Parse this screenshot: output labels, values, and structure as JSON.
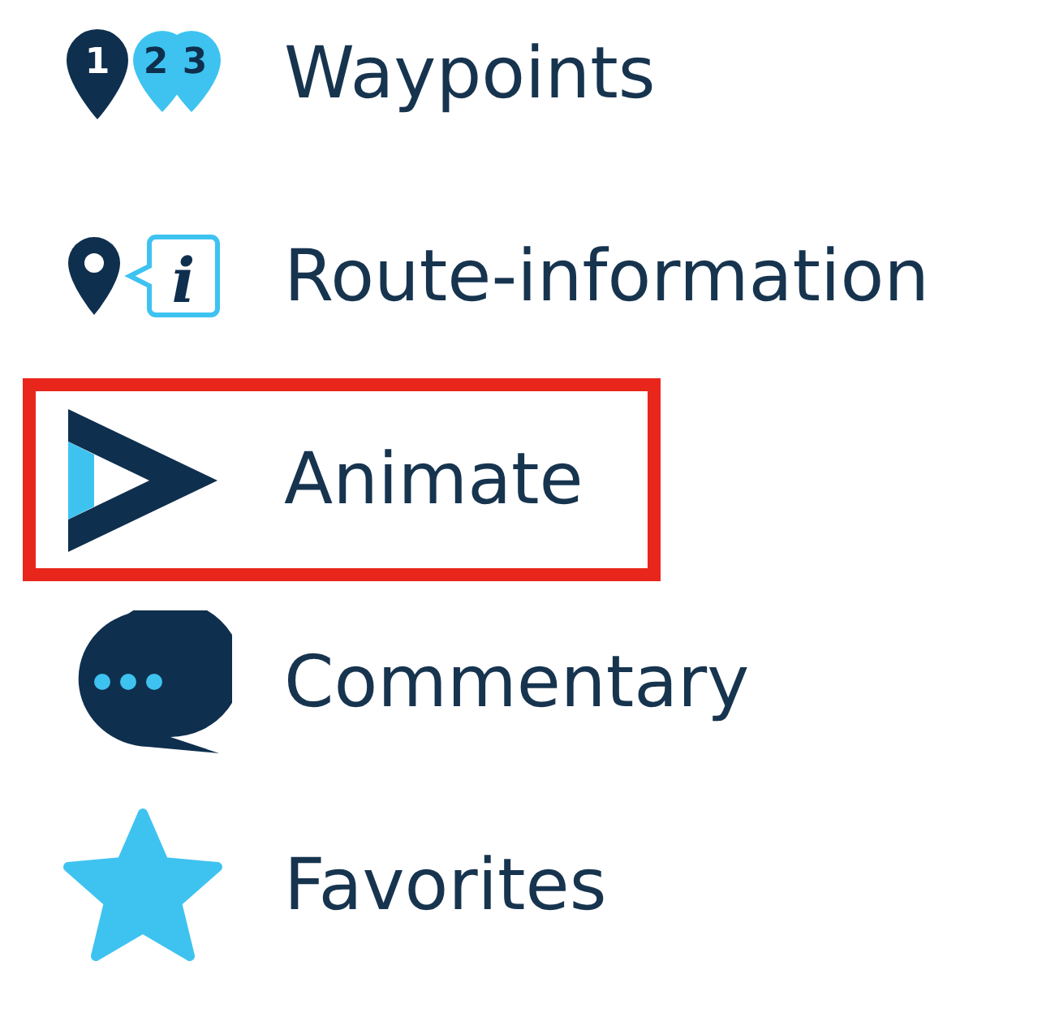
{
  "menu": {
    "items": [
      {
        "kind": "waypoints",
        "label": "Waypoints",
        "icon_text": [
          "1",
          "2",
          "3"
        ],
        "highlighted": false
      },
      {
        "kind": "route-info",
        "label": "Route-information",
        "icon_text": [
          "i"
        ],
        "highlighted": false
      },
      {
        "kind": "animate",
        "label": "Animate",
        "highlighted": true
      },
      {
        "kind": "commentary",
        "label": "Commentary",
        "highlighted": false
      },
      {
        "kind": "favorites",
        "label": "Favorites",
        "highlighted": false
      }
    ]
  }
}
